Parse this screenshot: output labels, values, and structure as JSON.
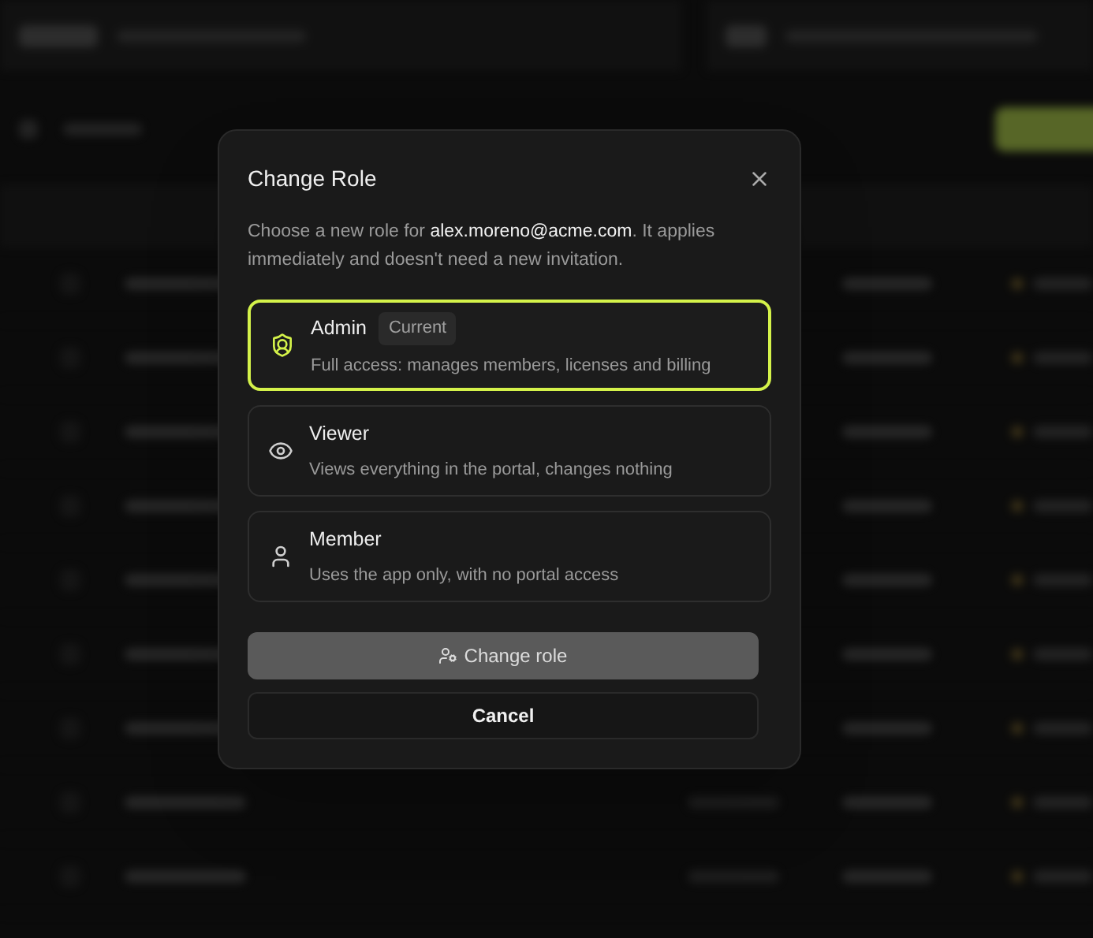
{
  "dialog": {
    "title": "Change Role",
    "description": "Choose a new role for **alex.moreno@acme.com**. It applies immediately and doesn't need a new invitation.",
    "roles": [
      {
        "kind": "admin",
        "name": "Admin",
        "badge": "Current",
        "description": "Full access: manages members, licenses and billing",
        "selected": true
      },
      {
        "kind": "viewer",
        "name": "Viewer",
        "description": "Views everything in the portal, changes nothing",
        "selected": false
      },
      {
        "kind": "member",
        "name": "Member",
        "description": "Uses the app only, with no portal access",
        "selected": false
      }
    ],
    "confirm_button": {
      "label": "Change role",
      "disabled": true
    },
    "cancel_button": {
      "label": "Cancel"
    }
  }
}
